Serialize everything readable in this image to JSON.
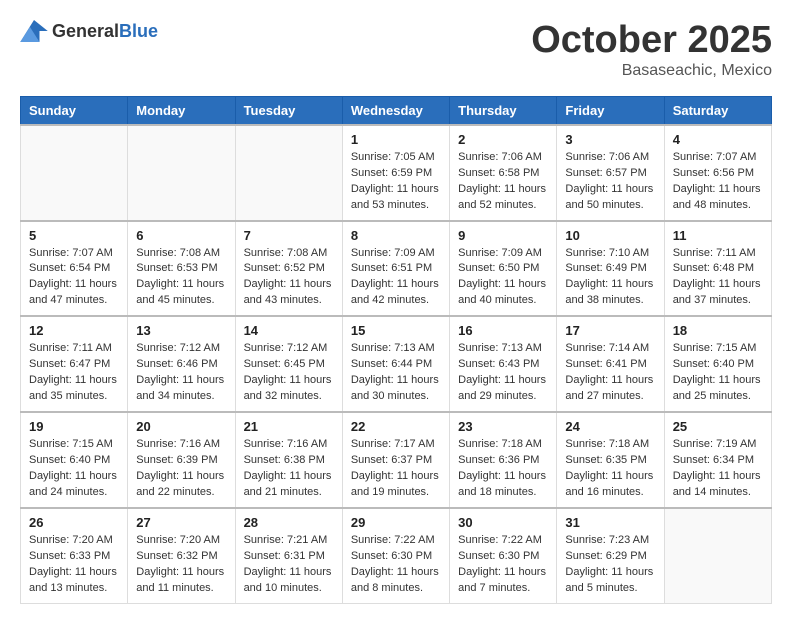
{
  "header": {
    "logo_general": "General",
    "logo_blue": "Blue",
    "month": "October 2025",
    "location": "Basaseachic, Mexico"
  },
  "weekdays": [
    "Sunday",
    "Monday",
    "Tuesday",
    "Wednesday",
    "Thursday",
    "Friday",
    "Saturday"
  ],
  "weeks": [
    [
      {
        "day": "",
        "sunrise": "",
        "sunset": "",
        "daylight": "",
        "empty": true
      },
      {
        "day": "",
        "sunrise": "",
        "sunset": "",
        "daylight": "",
        "empty": true
      },
      {
        "day": "",
        "sunrise": "",
        "sunset": "",
        "daylight": "",
        "empty": true
      },
      {
        "day": "1",
        "sunrise": "Sunrise: 7:05 AM",
        "sunset": "Sunset: 6:59 PM",
        "daylight": "Daylight: 11 hours and 53 minutes."
      },
      {
        "day": "2",
        "sunrise": "Sunrise: 7:06 AM",
        "sunset": "Sunset: 6:58 PM",
        "daylight": "Daylight: 11 hours and 52 minutes."
      },
      {
        "day": "3",
        "sunrise": "Sunrise: 7:06 AM",
        "sunset": "Sunset: 6:57 PM",
        "daylight": "Daylight: 11 hours and 50 minutes."
      },
      {
        "day": "4",
        "sunrise": "Sunrise: 7:07 AM",
        "sunset": "Sunset: 6:56 PM",
        "daylight": "Daylight: 11 hours and 48 minutes."
      }
    ],
    [
      {
        "day": "5",
        "sunrise": "Sunrise: 7:07 AM",
        "sunset": "Sunset: 6:54 PM",
        "daylight": "Daylight: 11 hours and 47 minutes."
      },
      {
        "day": "6",
        "sunrise": "Sunrise: 7:08 AM",
        "sunset": "Sunset: 6:53 PM",
        "daylight": "Daylight: 11 hours and 45 minutes."
      },
      {
        "day": "7",
        "sunrise": "Sunrise: 7:08 AM",
        "sunset": "Sunset: 6:52 PM",
        "daylight": "Daylight: 11 hours and 43 minutes."
      },
      {
        "day": "8",
        "sunrise": "Sunrise: 7:09 AM",
        "sunset": "Sunset: 6:51 PM",
        "daylight": "Daylight: 11 hours and 42 minutes."
      },
      {
        "day": "9",
        "sunrise": "Sunrise: 7:09 AM",
        "sunset": "Sunset: 6:50 PM",
        "daylight": "Daylight: 11 hours and 40 minutes."
      },
      {
        "day": "10",
        "sunrise": "Sunrise: 7:10 AM",
        "sunset": "Sunset: 6:49 PM",
        "daylight": "Daylight: 11 hours and 38 minutes."
      },
      {
        "day": "11",
        "sunrise": "Sunrise: 7:11 AM",
        "sunset": "Sunset: 6:48 PM",
        "daylight": "Daylight: 11 hours and 37 minutes."
      }
    ],
    [
      {
        "day": "12",
        "sunrise": "Sunrise: 7:11 AM",
        "sunset": "Sunset: 6:47 PM",
        "daylight": "Daylight: 11 hours and 35 minutes."
      },
      {
        "day": "13",
        "sunrise": "Sunrise: 7:12 AM",
        "sunset": "Sunset: 6:46 PM",
        "daylight": "Daylight: 11 hours and 34 minutes."
      },
      {
        "day": "14",
        "sunrise": "Sunrise: 7:12 AM",
        "sunset": "Sunset: 6:45 PM",
        "daylight": "Daylight: 11 hours and 32 minutes."
      },
      {
        "day": "15",
        "sunrise": "Sunrise: 7:13 AM",
        "sunset": "Sunset: 6:44 PM",
        "daylight": "Daylight: 11 hours and 30 minutes."
      },
      {
        "day": "16",
        "sunrise": "Sunrise: 7:13 AM",
        "sunset": "Sunset: 6:43 PM",
        "daylight": "Daylight: 11 hours and 29 minutes."
      },
      {
        "day": "17",
        "sunrise": "Sunrise: 7:14 AM",
        "sunset": "Sunset: 6:41 PM",
        "daylight": "Daylight: 11 hours and 27 minutes."
      },
      {
        "day": "18",
        "sunrise": "Sunrise: 7:15 AM",
        "sunset": "Sunset: 6:40 PM",
        "daylight": "Daylight: 11 hours and 25 minutes."
      }
    ],
    [
      {
        "day": "19",
        "sunrise": "Sunrise: 7:15 AM",
        "sunset": "Sunset: 6:40 PM",
        "daylight": "Daylight: 11 hours and 24 minutes."
      },
      {
        "day": "20",
        "sunrise": "Sunrise: 7:16 AM",
        "sunset": "Sunset: 6:39 PM",
        "daylight": "Daylight: 11 hours and 22 minutes."
      },
      {
        "day": "21",
        "sunrise": "Sunrise: 7:16 AM",
        "sunset": "Sunset: 6:38 PM",
        "daylight": "Daylight: 11 hours and 21 minutes."
      },
      {
        "day": "22",
        "sunrise": "Sunrise: 7:17 AM",
        "sunset": "Sunset: 6:37 PM",
        "daylight": "Daylight: 11 hours and 19 minutes."
      },
      {
        "day": "23",
        "sunrise": "Sunrise: 7:18 AM",
        "sunset": "Sunset: 6:36 PM",
        "daylight": "Daylight: 11 hours and 18 minutes."
      },
      {
        "day": "24",
        "sunrise": "Sunrise: 7:18 AM",
        "sunset": "Sunset: 6:35 PM",
        "daylight": "Daylight: 11 hours and 16 minutes."
      },
      {
        "day": "25",
        "sunrise": "Sunrise: 7:19 AM",
        "sunset": "Sunset: 6:34 PM",
        "daylight": "Daylight: 11 hours and 14 minutes."
      }
    ],
    [
      {
        "day": "26",
        "sunrise": "Sunrise: 7:20 AM",
        "sunset": "Sunset: 6:33 PM",
        "daylight": "Daylight: 11 hours and 13 minutes."
      },
      {
        "day": "27",
        "sunrise": "Sunrise: 7:20 AM",
        "sunset": "Sunset: 6:32 PM",
        "daylight": "Daylight: 11 hours and 11 minutes."
      },
      {
        "day": "28",
        "sunrise": "Sunrise: 7:21 AM",
        "sunset": "Sunset: 6:31 PM",
        "daylight": "Daylight: 11 hours and 10 minutes."
      },
      {
        "day": "29",
        "sunrise": "Sunrise: 7:22 AM",
        "sunset": "Sunset: 6:30 PM",
        "daylight": "Daylight: 11 hours and 8 minutes."
      },
      {
        "day": "30",
        "sunrise": "Sunrise: 7:22 AM",
        "sunset": "Sunset: 6:30 PM",
        "daylight": "Daylight: 11 hours and 7 minutes."
      },
      {
        "day": "31",
        "sunrise": "Sunrise: 7:23 AM",
        "sunset": "Sunset: 6:29 PM",
        "daylight": "Daylight: 11 hours and 5 minutes."
      },
      {
        "day": "",
        "sunrise": "",
        "sunset": "",
        "daylight": "",
        "empty": true
      }
    ]
  ]
}
